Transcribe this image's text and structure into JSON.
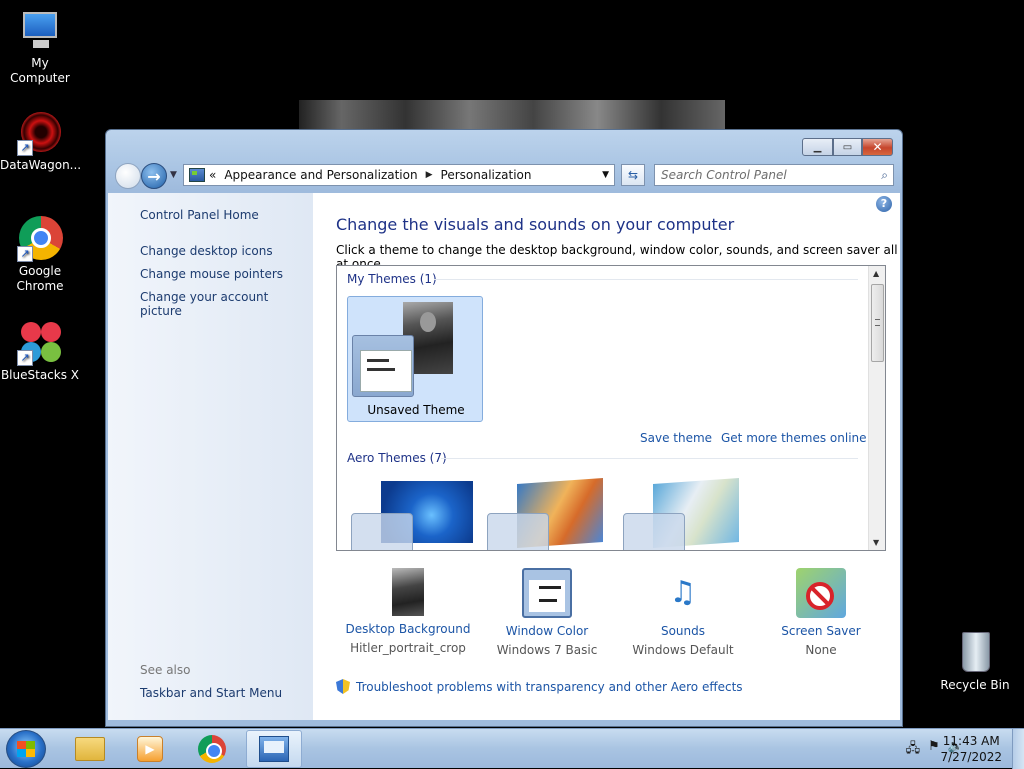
{
  "desktop": {
    "icons": [
      {
        "label": "My Computer"
      },
      {
        "label": "DataWagon..."
      },
      {
        "label": "Google Chrome"
      },
      {
        "label": "BlueStacks X"
      },
      {
        "label": "Recycle Bin"
      }
    ]
  },
  "window": {
    "address": {
      "overflow": "«",
      "crumbs": [
        "Appearance and Personalization",
        "Personalization"
      ]
    },
    "search_placeholder": "Search Control Panel",
    "left_pane": {
      "home": "Control Panel Home",
      "links": [
        "Change desktop icons",
        "Change mouse pointers",
        "Change your account picture"
      ],
      "see_also_title": "See also",
      "see_also": [
        "Taskbar and Start Menu"
      ]
    },
    "main": {
      "title": "Change the visuals and sounds on your computer",
      "subtitle": "Click a theme to change the desktop background, window color, sounds, and screen saver all at once.",
      "my_themes_header": "My Themes (1)",
      "selected_theme": "Unsaved Theme",
      "save_theme": "Save theme",
      "get_more": "Get more themes online",
      "aero_header": "Aero Themes (7)",
      "options": [
        {
          "label": "Desktop Background",
          "value": "Hitler_portrait_crop",
          "icon": "portrait-icon"
        },
        {
          "label": "Window Color",
          "value": "Windows 7 Basic",
          "icon": "window-color-icon"
        },
        {
          "label": "Sounds",
          "value": "Windows Default",
          "icon": "sounds-icon"
        },
        {
          "label": "Screen Saver",
          "value": "None",
          "icon": "screen-saver-icon"
        }
      ],
      "troubleshoot": "Troubleshoot problems with transparency and other Aero effects"
    }
  },
  "taskbar": {
    "time": "11:43 AM",
    "date": "7/27/2022"
  }
}
